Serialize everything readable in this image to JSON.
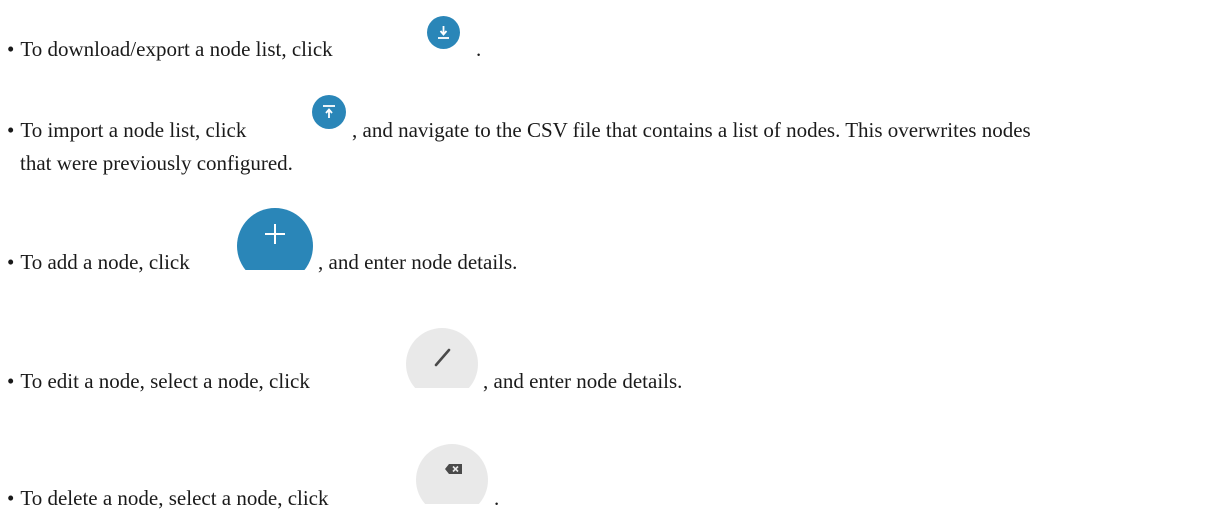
{
  "bullets": [
    {
      "symbol": "•",
      "text_before": "To download/export a node list, click",
      "text_after": ".",
      "icon": "download-icon",
      "icon_color": "#2a86b8"
    },
    {
      "symbol": "•",
      "text_before": "To import a node list, click",
      "text_after": ", and navigate to the CSV file that contains a list of nodes. This overwrites nodes",
      "continuation": "that were previously configured.",
      "icon": "upload-icon",
      "icon_color": "#2a86b8"
    },
    {
      "symbol": "•",
      "text_before": "To add a node, click",
      "text_after": ", and enter node details.",
      "icon": "plus-icon",
      "icon_color": "#2a86b8"
    },
    {
      "symbol": "•",
      "text_before": "To edit a node, select a node, click",
      "text_after": ", and enter node details.",
      "icon": "pencil-icon",
      "icon_color": "#e9e9e9"
    },
    {
      "symbol": "•",
      "text_before": "To delete a node, select a node, click",
      "text_after": ".",
      "icon": "backspace-icon",
      "icon_color": "#e9e9e9"
    }
  ]
}
